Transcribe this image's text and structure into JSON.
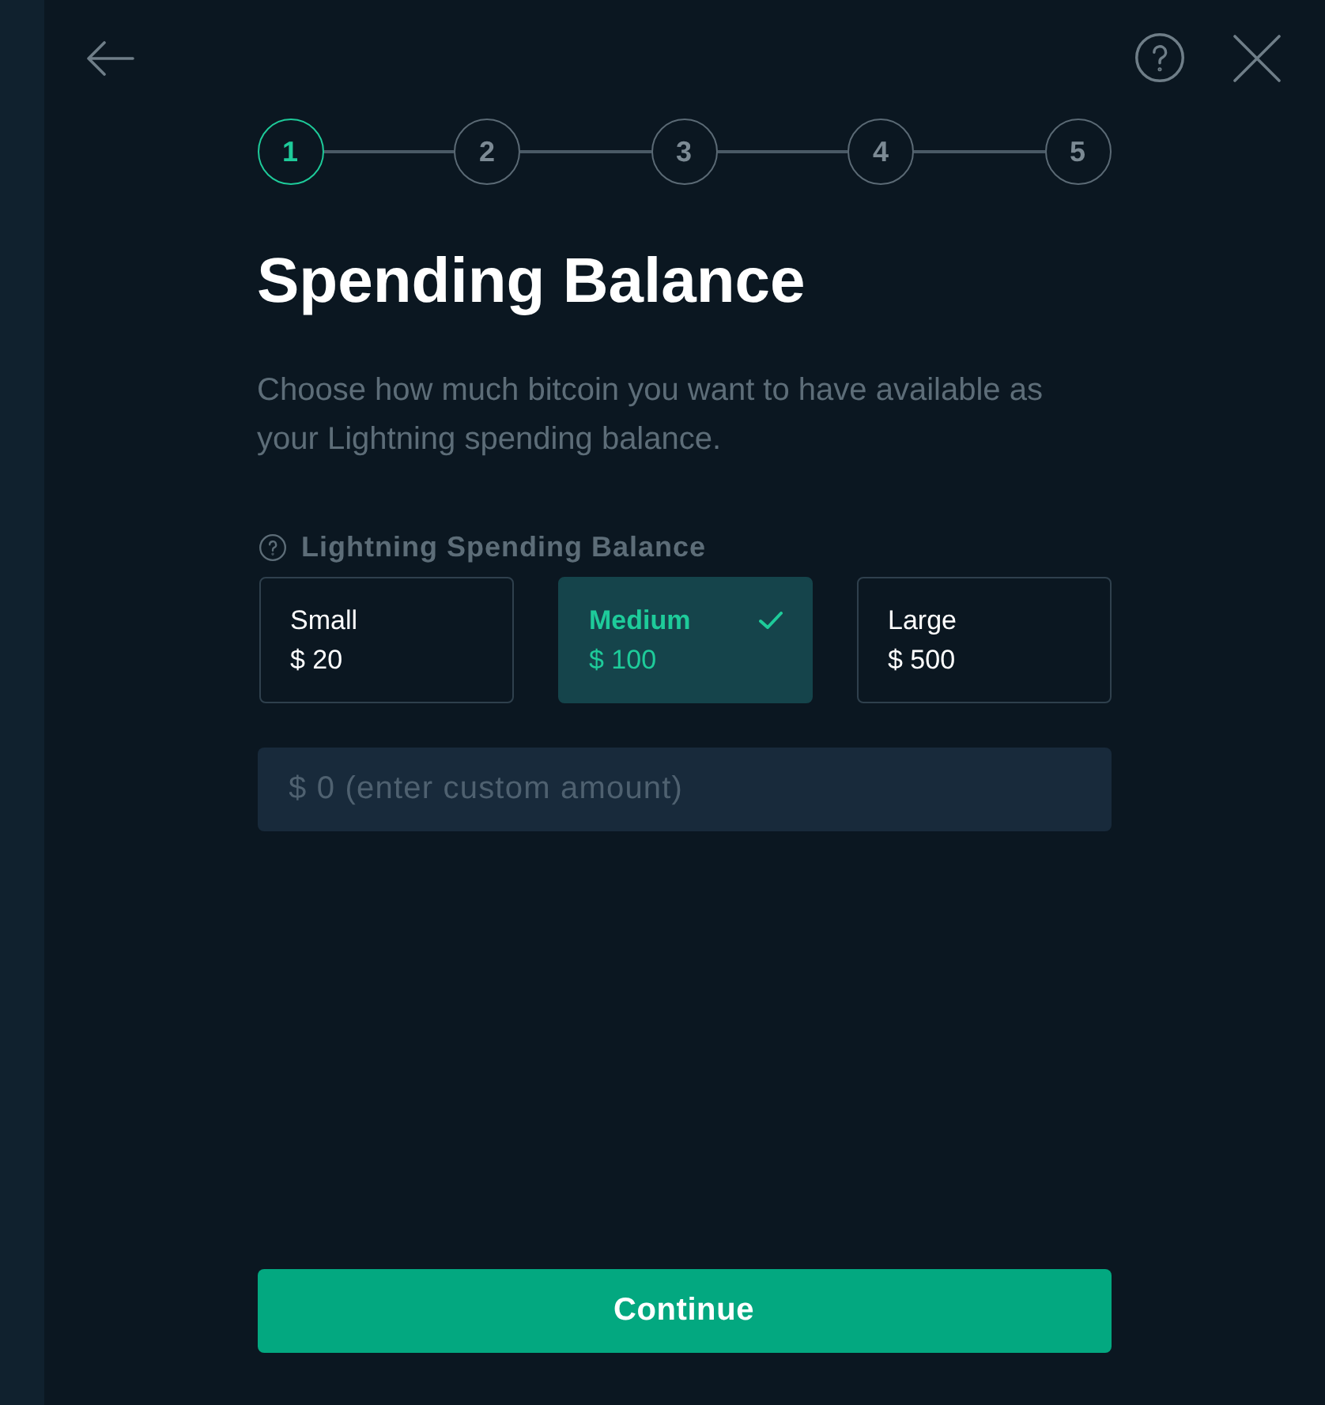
{
  "steps": [
    {
      "label": "1",
      "selected": true
    },
    {
      "label": "2",
      "selected": false
    },
    {
      "label": "3",
      "selected": false
    },
    {
      "label": "4",
      "selected": false
    },
    {
      "label": "5",
      "selected": false
    }
  ],
  "title": "Spending Balance",
  "description": "Choose how much bitcoin you want to have available as your Lightning spending balance.",
  "balance_field": {
    "label": "Lightning Spending Balance"
  },
  "options": [
    {
      "name": "Small",
      "amount": "$ 20",
      "selected": false
    },
    {
      "name": "Medium",
      "amount": "$ 100",
      "selected": true
    },
    {
      "name": "Large",
      "amount": "$ 500",
      "selected": false
    }
  ],
  "custom_amount": {
    "placeholder": "$ 0 (enter custom amount)"
  },
  "continue_button": {
    "label": "Continue"
  }
}
